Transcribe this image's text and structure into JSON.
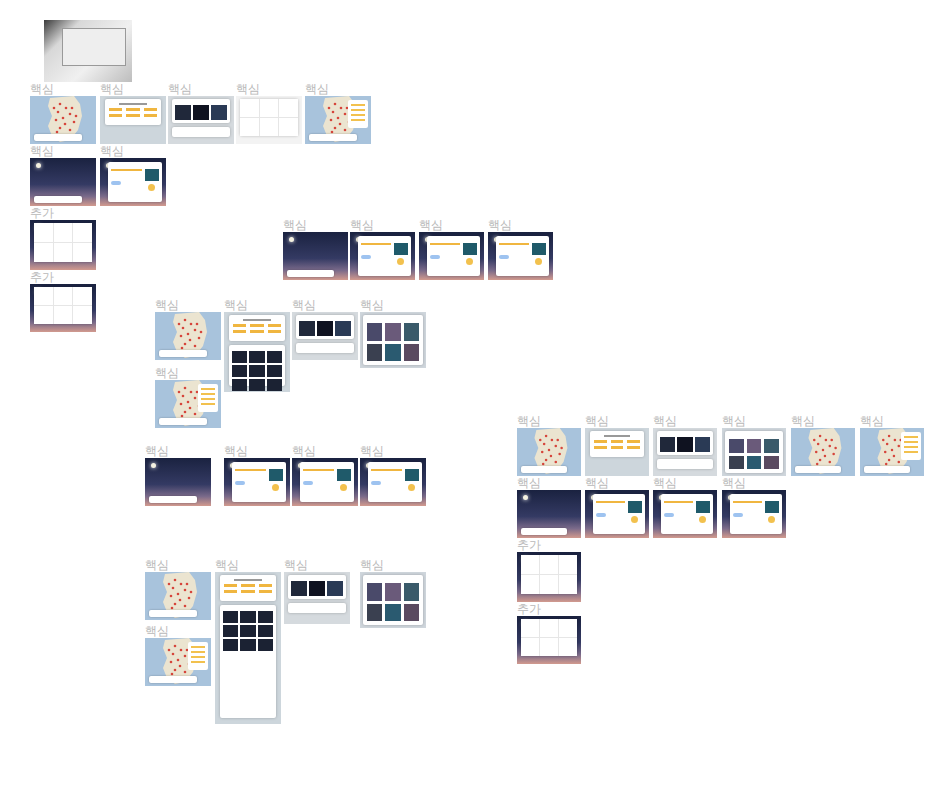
{
  "reference_photo": {
    "kind": "photo"
  },
  "frames": [
    {
      "label": "핵심",
      "kind": "map"
    },
    {
      "label": "핵심",
      "kind": "panel"
    },
    {
      "label": "핵심",
      "kind": "dark-cards"
    },
    {
      "label": "핵심",
      "kind": "grid"
    },
    {
      "label": "핵심",
      "kind": "map-side"
    },
    {
      "label": "핵심",
      "kind": "sky"
    },
    {
      "label": "핵심",
      "kind": "sky-panel"
    },
    {
      "label": "추가",
      "kind": "grid-sky"
    },
    {
      "label": "추가",
      "kind": "grid-sky"
    },
    {
      "label": "핵심",
      "kind": "sky"
    },
    {
      "label": "핵심",
      "kind": "sky-panel"
    },
    {
      "label": "핵심",
      "kind": "sky-panel"
    },
    {
      "label": "핵심",
      "kind": "sky-panel"
    },
    {
      "label": "핵심",
      "kind": "map"
    },
    {
      "label": "핵심",
      "kind": "panel"
    },
    {
      "label": "핵심",
      "kind": "dark-cards"
    },
    {
      "label": "핵심",
      "kind": "rating"
    },
    {
      "label": "핵심",
      "kind": "map-side"
    },
    {
      "label": "핵심",
      "kind": "sky"
    },
    {
      "label": "핵심",
      "kind": "sky-panel"
    },
    {
      "label": "핵심",
      "kind": "sky-panel"
    },
    {
      "label": "핵심",
      "kind": "sky-panel"
    },
    {
      "label": "핵심",
      "kind": "map"
    },
    {
      "label": "핵심",
      "kind": "panel"
    },
    {
      "label": "핵심",
      "kind": "dark-cards"
    },
    {
      "label": "핵심",
      "kind": "rating"
    },
    {
      "label": "핵심",
      "kind": "map-side"
    },
    {
      "label": "핵심",
      "kind": "map"
    },
    {
      "label": "핵심",
      "kind": "panel"
    },
    {
      "label": "핵심",
      "kind": "dark-cards"
    },
    {
      "label": "핵심",
      "kind": "rating"
    },
    {
      "label": "핵심",
      "kind": "map"
    },
    {
      "label": "핵심",
      "kind": "map-side"
    },
    {
      "label": "핵심",
      "kind": "sky"
    },
    {
      "label": "핵심",
      "kind": "sky-panel"
    },
    {
      "label": "핵심",
      "kind": "sky-panel"
    },
    {
      "label": "핵심",
      "kind": "sky-panel"
    },
    {
      "label": "추가",
      "kind": "grid-sky"
    },
    {
      "label": "추가",
      "kind": "grid-sky"
    }
  ]
}
